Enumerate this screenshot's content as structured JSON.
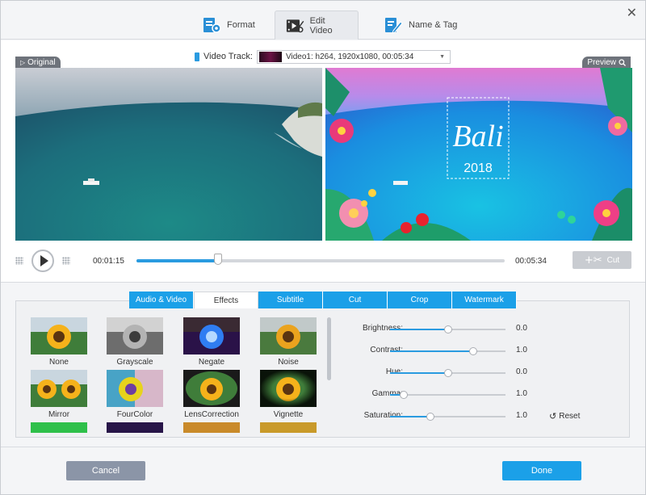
{
  "top_tabs": [
    {
      "label": "Format",
      "icon": "format-icon"
    },
    {
      "label": "Edit Video",
      "icon": "edit-video-icon",
      "active": true
    },
    {
      "label": "Name & Tag",
      "icon": "name-tag-icon"
    }
  ],
  "video_track": {
    "label": "Video Track:",
    "value": "Video1: h264, 1920x1080, 00:05:34"
  },
  "original_badge": "Original",
  "preview_badge": "Preview",
  "preview_overlay": {
    "title": "Bali",
    "year": "2018"
  },
  "player": {
    "current_time": "00:01:15",
    "total_time": "00:05:34",
    "progress_percent": 22.4,
    "cut_label": "Cut"
  },
  "edit_tabs": [
    {
      "label": "Audio & Video"
    },
    {
      "label": "Effects",
      "active": true
    },
    {
      "label": "Subtitle"
    },
    {
      "label": "Cut"
    },
    {
      "label": "Crop"
    },
    {
      "label": "Watermark"
    }
  ],
  "effects": [
    "None",
    "Grayscale",
    "Negate",
    "Noise",
    "Mirror",
    "FourColor",
    "LensCorrection",
    "Vignette"
  ],
  "adjustments": [
    {
      "label": "Brightness:",
      "value": "0.0",
      "fraction": 0.5
    },
    {
      "label": "Contrast:",
      "value": "1.0",
      "fraction": 0.72
    },
    {
      "label": "Hue:",
      "value": "0.0",
      "fraction": 0.5
    },
    {
      "label": "Gamma:",
      "value": "1.0",
      "fraction": 0.12
    },
    {
      "label": "Saturation:",
      "value": "1.0",
      "fraction": 0.35
    }
  ],
  "reset_label": "Reset",
  "buttons": {
    "cancel": "Cancel",
    "done": "Done"
  },
  "colors": {
    "accent": "#1ba0e8",
    "cancel": "#8b95a7"
  }
}
